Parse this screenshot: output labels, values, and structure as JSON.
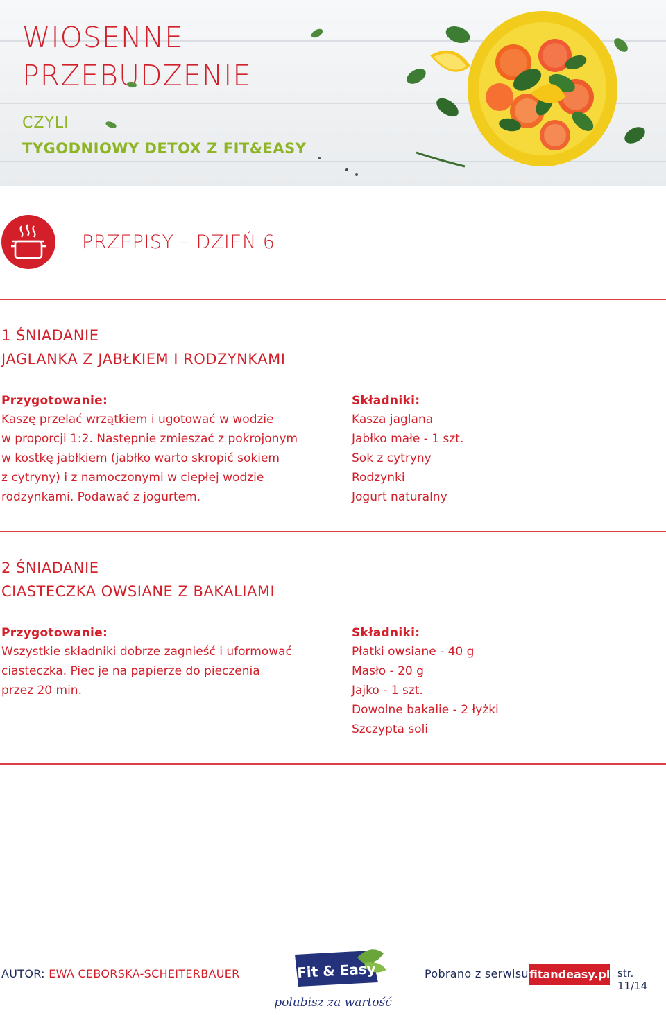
{
  "header": {
    "title_line1": "WIOSENNE",
    "title_line2": "PRZEBUDZENIE",
    "subtitle_line1": "CZYLI",
    "subtitle_line2": "TYGODNIOWY DETOX Z FIT&EASY"
  },
  "section": {
    "icon": "cooking-pot-icon",
    "title": "PRZEPISY – DZIEŃ 6"
  },
  "meals": [
    {
      "number": "1 ŚNIADANIE",
      "name": "JAGLANKA Z JABŁKIEM I RODZYNKAMI",
      "prep_label": "Przygotowanie:",
      "prep_lines": [
        "Kaszę przelać wrzątkiem i ugotować w wodzie",
        "w proporcji 1:2. Następnie zmieszać z pokrojonym",
        "w kostkę jabłkiem (jabłko warto skropić sokiem",
        "z cytryny) i z namoczonymi w ciepłej wodzie",
        "rodzynkami. Podawać z jogurtem."
      ],
      "ingredients_label": "Składniki:",
      "ingredients": [
        "Kasza jaglana",
        "Jabłko małe - 1 szt.",
        "Sok z cytryny",
        "Rodzynki",
        "Jogurt naturalny"
      ]
    },
    {
      "number": "2 ŚNIADANIE",
      "name": "CIASTECZKA OWSIANE Z BAKALIAMI",
      "prep_label": "Przygotowanie:",
      "prep_lines": [
        "Wszystkie składniki dobrze zagnieść i uformować",
        "ciasteczka. Piec je na papierze do pieczenia",
        "przez 20 min."
      ],
      "ingredients_label": "Składniki:",
      "ingredients": [
        "Płatki owsiane - 40 g",
        "Masło - 20 g",
        "Jajko - 1 szt.",
        "Dowolne bakalie - 2 łyżki",
        "Szczypta soli"
      ]
    }
  ],
  "footer": {
    "author_label": "AUTOR:",
    "author_name": "EWA CEBORSKA-SCHEITERBAUER",
    "logo_text": "Fit & Easy",
    "slogan": "polubisz za wartość",
    "downloaded_label": "Pobrano z serwisu:",
    "site": "fitandeasy.pl",
    "page": "str. 11/14"
  },
  "colors": {
    "accent_red": "#d21f2a",
    "accent_green": "#8fb526",
    "navy": "#1f2a5a"
  }
}
